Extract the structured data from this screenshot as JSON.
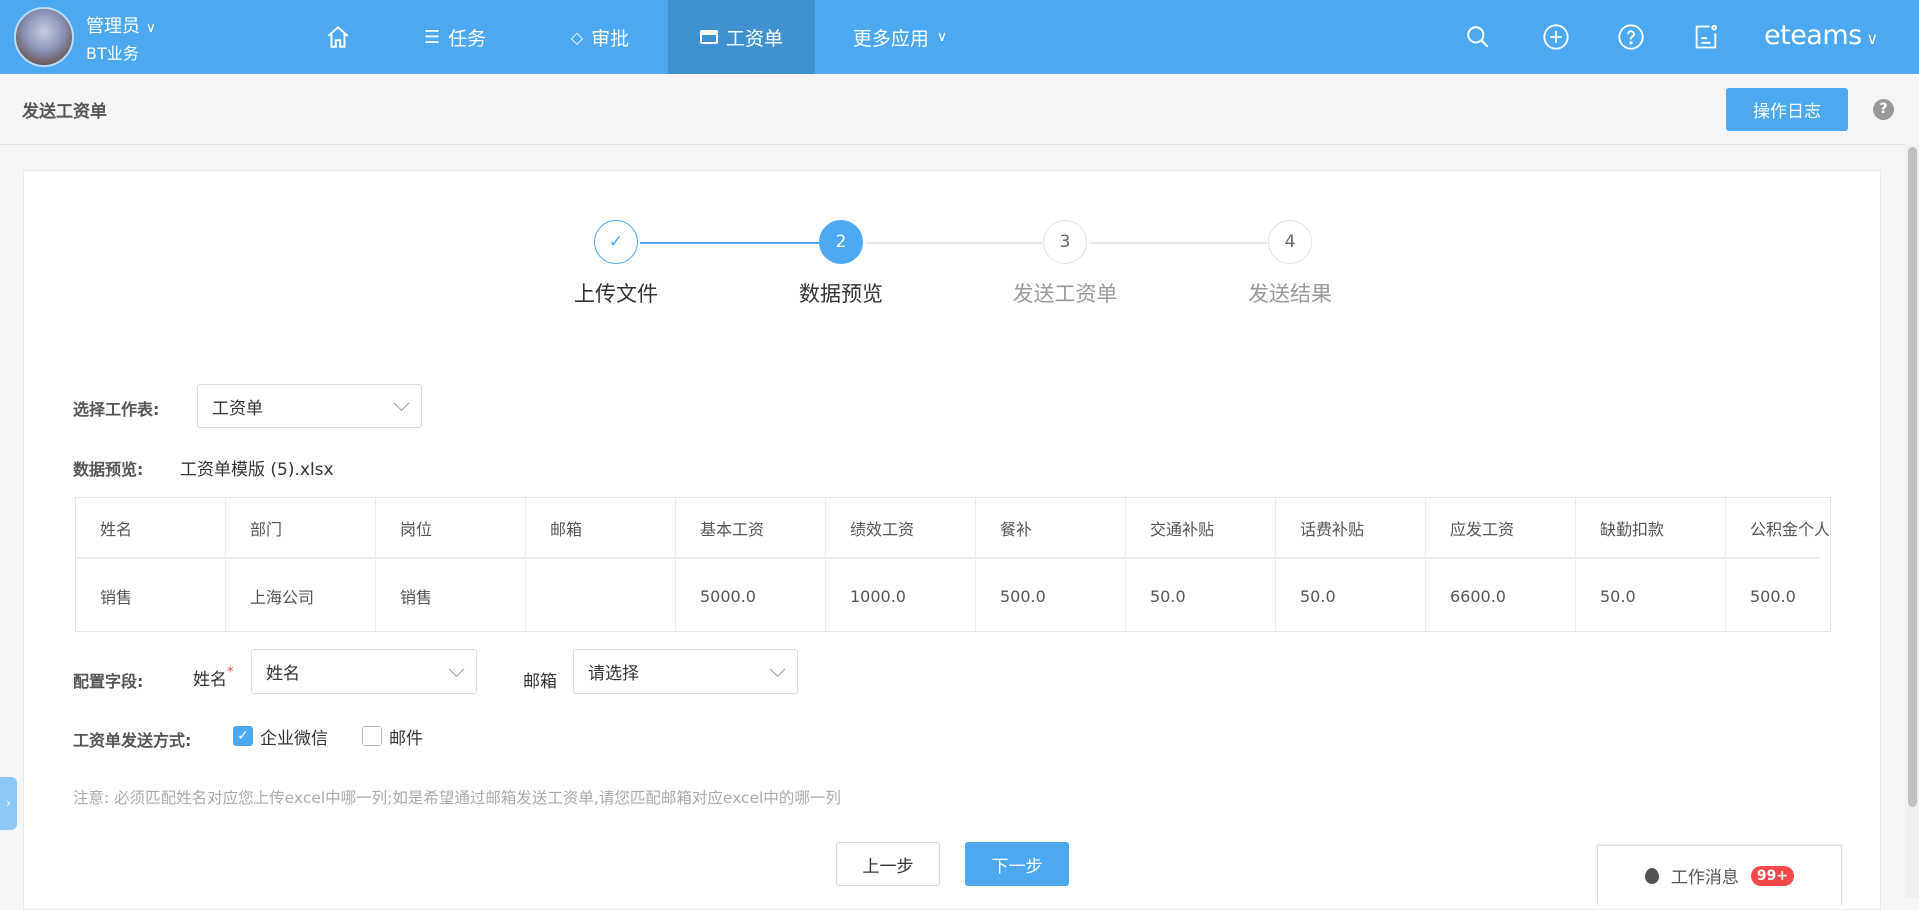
{
  "user": {
    "name": "管理员",
    "org": "BT业务"
  },
  "nav": [
    {
      "label": "任务"
    },
    {
      "label": "审批"
    },
    {
      "label": "工资单"
    },
    {
      "label": "更多应用"
    }
  ],
  "brand": "eteams",
  "page": {
    "title": "发送工资单",
    "log_button": "操作日志",
    "help": "?"
  },
  "steps": [
    {
      "label": "上传文件",
      "num": "✓"
    },
    {
      "label": "数据预览",
      "num": "2"
    },
    {
      "label": "发送工资单",
      "num": "3"
    },
    {
      "label": "发送结果",
      "num": "4"
    }
  ],
  "sheet": {
    "label": "选择工作表:",
    "value": "工资单"
  },
  "preview": {
    "label": "数据预览:",
    "file": "工资单模版 (5).xlsx"
  },
  "table": {
    "headers": [
      "姓名",
      "部门",
      "岗位",
      "邮箱",
      "基本工资",
      "绩效工资",
      "餐补",
      "交通补贴",
      "话费补贴",
      "应发工资",
      "缺勤扣款",
      "公积金个人"
    ],
    "rows": [
      [
        "销售",
        "上海公司",
        "销售",
        "",
        "5000.0",
        "1000.0",
        "500.0",
        "50.0",
        "50.0",
        "6600.0",
        "50.0",
        "500.0"
      ]
    ]
  },
  "config": {
    "label": "配置字段:",
    "name_label": "姓名",
    "required": "*",
    "name_value": "姓名",
    "email_label": "邮箱",
    "email_placeholder": "请选择"
  },
  "send": {
    "label": "工资单发送方式:",
    "wechat": "企业微信",
    "wechat_checked": true,
    "mail": "邮件",
    "mail_checked": false
  },
  "note": "注意: 必须匹配姓名对应您上传excel中哪一列;如是希望通过邮箱发送工资单,请您匹配邮箱对应excel中的哪一列",
  "buttons": {
    "prev": "上一步",
    "next": "下一步"
  },
  "messages": {
    "label": "工作消息",
    "badge": "99+"
  },
  "colors": {
    "accent": "#4ca8f1",
    "badge": "#f5484d"
  }
}
